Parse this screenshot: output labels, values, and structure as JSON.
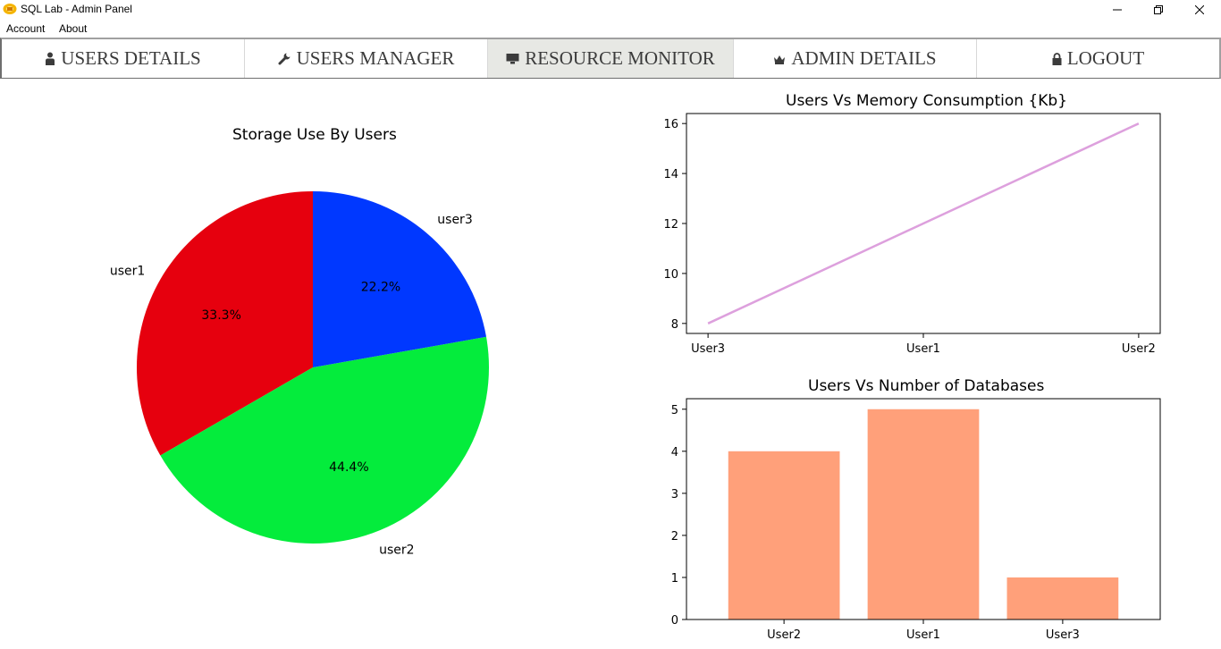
{
  "window": {
    "title": "SQL Lab - Admin Panel"
  },
  "menu": {
    "items": [
      "Account",
      "About"
    ]
  },
  "tabs": [
    {
      "label": "USERS DETAILS",
      "icon": "person-icon"
    },
    {
      "label": "USERS MANAGER",
      "icon": "wrench-icon"
    },
    {
      "label": "RESOURCE MONITOR",
      "icon": "monitor-icon",
      "active": true
    },
    {
      "label": "ADMIN DETAILS",
      "icon": "crown-icon"
    },
    {
      "label": "LOGOUT",
      "icon": "lock-icon"
    }
  ],
  "chart_data": [
    {
      "type": "pie",
      "title": "Storage Use By Users",
      "labels": [
        "user1",
        "user2",
        "user3"
      ],
      "values": [
        33.3,
        44.4,
        22.2
      ],
      "autopct": [
        "33.3%",
        "44.4%",
        "22.2%"
      ],
      "colors": [
        "#e6000e",
        "#04ec3c",
        "#0038ff"
      ],
      "startangle_deg": 90
    },
    {
      "type": "line",
      "title": "Users Vs Memory Consumption {Kb}",
      "categories": [
        "User3",
        "User1",
        "User2"
      ],
      "values": [
        8,
        12,
        16
      ],
      "ylim": [
        7.6,
        16.4
      ],
      "yticks": [
        8,
        10,
        12,
        14,
        16
      ],
      "color": "#dda0dd"
    },
    {
      "type": "bar",
      "title": "Users Vs Number of Databases",
      "categories": [
        "User2",
        "User1",
        "User3"
      ],
      "values": [
        4,
        5,
        1
      ],
      "ylim": [
        0,
        5.25
      ],
      "yticks": [
        0,
        1,
        2,
        3,
        4,
        5
      ],
      "color": "#ffa07a"
    }
  ]
}
